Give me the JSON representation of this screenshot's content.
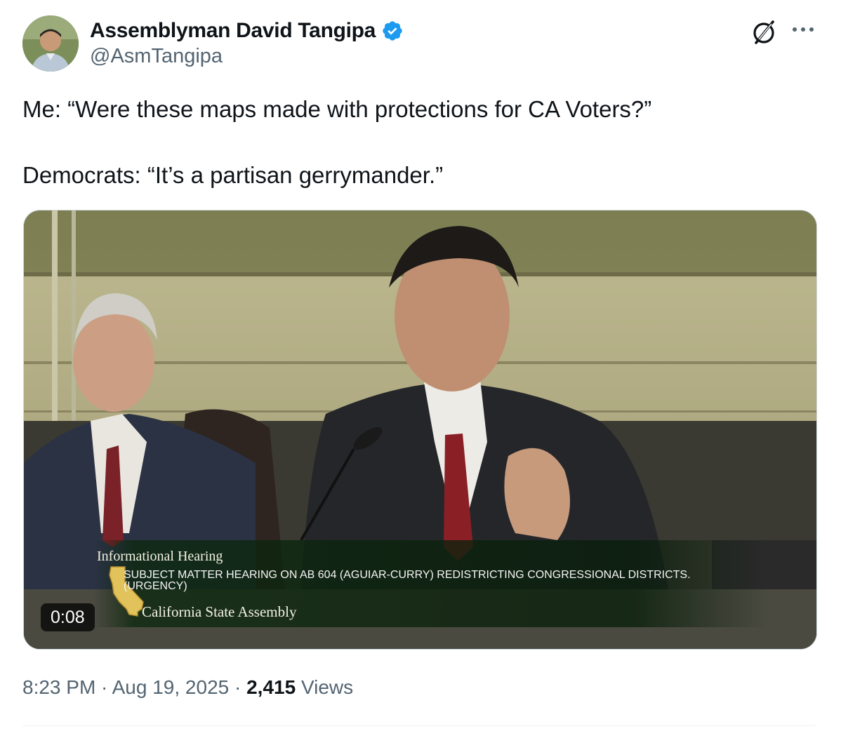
{
  "author": {
    "display_name": "Assemblyman David Tangipa",
    "handle": "@AsmTangipa",
    "verified_color": "#1d9bf0"
  },
  "tweet": {
    "lines": [
      "Me:  “Were these maps made with protections for CA Voters?”",
      "Democrats:  “It’s a partisan gerrymander.”"
    ]
  },
  "video": {
    "duration": "0:08",
    "lower_third": {
      "title": "Informational Hearing",
      "subject": "SUBJECT MATTER HEARING ON AB 604 (AGUIAR-CURRY) REDISTRICTING CONGRESSIONAL DISTRICTS.(URGENCY)",
      "source": "California State Assembly"
    }
  },
  "meta": {
    "time": "8:23 PM",
    "separator": " · ",
    "date": "Aug 19, 2025",
    "views_count": "2,415",
    "views_label": " Views"
  },
  "icons": {
    "grok": "grok-icon",
    "more": "more-icon",
    "verified": "verified-badge-icon"
  }
}
